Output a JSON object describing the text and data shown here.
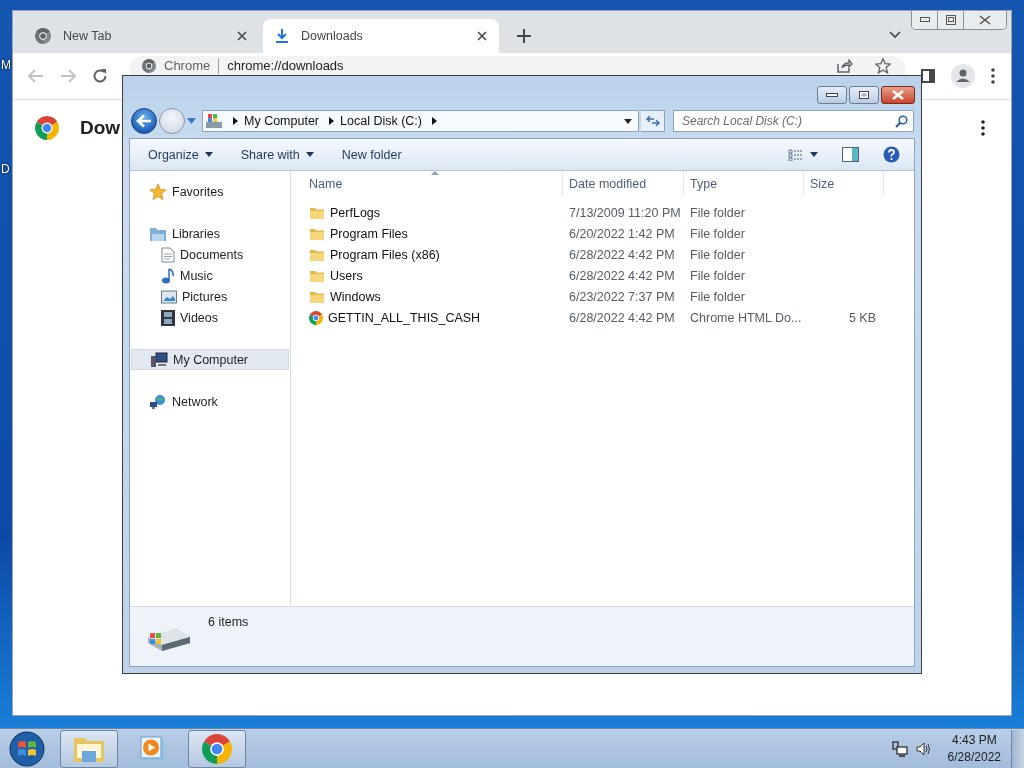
{
  "desktop": {
    "labels": [
      "M",
      "D"
    ]
  },
  "browser": {
    "tabs": [
      {
        "title": "New Tab",
        "selected": false
      },
      {
        "title": "Downloads",
        "selected": true
      }
    ],
    "address": {
      "origin": "Chrome",
      "url": "chrome://downloads"
    },
    "page_title": "Dow"
  },
  "explorer": {
    "breadcrumb": [
      "My Computer",
      "Local Disk (C:)"
    ],
    "search": {
      "placeholder": "Search Local Disk (C:)"
    },
    "toolbar": [
      {
        "label": "Organize",
        "dropdown": true
      },
      {
        "label": "Share with",
        "dropdown": true
      },
      {
        "label": "New folder",
        "dropdown": false
      }
    ],
    "nav": [
      {
        "label": "Favorites",
        "selected": false
      },
      {
        "label": "Libraries",
        "selected": false,
        "children": [
          {
            "label": "Documents",
            "selected": false
          },
          {
            "label": "Music",
            "selected": false
          },
          {
            "label": "Pictures",
            "selected": false
          },
          {
            "label": "Videos",
            "selected": false
          }
        ]
      },
      {
        "label": "My Computer",
        "selected": true
      },
      {
        "label": "Network",
        "selected": false
      }
    ],
    "columns": [
      {
        "label": "Name",
        "sorted": true
      },
      {
        "label": "Date modified",
        "sorted": false
      },
      {
        "label": "Type",
        "sorted": false
      },
      {
        "label": "Size",
        "sorted": false
      }
    ],
    "rows": [
      {
        "kind": "folder",
        "name": "PerfLogs",
        "date": "7/13/2009 11:20 PM",
        "type": "File folder"
      },
      {
        "kind": "folder",
        "name": "Program Files",
        "date": "6/20/2022 1:42 PM",
        "type": "File folder"
      },
      {
        "kind": "folder",
        "name": "Program Files (x86)",
        "date": "6/28/2022 4:42 PM",
        "type": "File folder"
      },
      {
        "kind": "folder",
        "name": "Users",
        "date": "6/28/2022 4:42 PM",
        "type": "File folder"
      },
      {
        "kind": "folder",
        "name": "Windows",
        "date": "6/23/2022 7:37 PM",
        "type": "File folder"
      },
      {
        "kind": "chrome",
        "name": "GETTIN_ALL_THIS_CASH",
        "date": "6/28/2022 4:42 PM",
        "type": "Chrome HTML Do...",
        "size": "5 KB"
      }
    ],
    "status": "6 items"
  },
  "taskbar": {
    "items": [
      {
        "kind": "explorer",
        "open": true
      },
      {
        "kind": "media",
        "open": false
      },
      {
        "kind": "chrome",
        "open": true
      }
    ],
    "time": "4:43 PM",
    "date": "6/28/2022"
  }
}
